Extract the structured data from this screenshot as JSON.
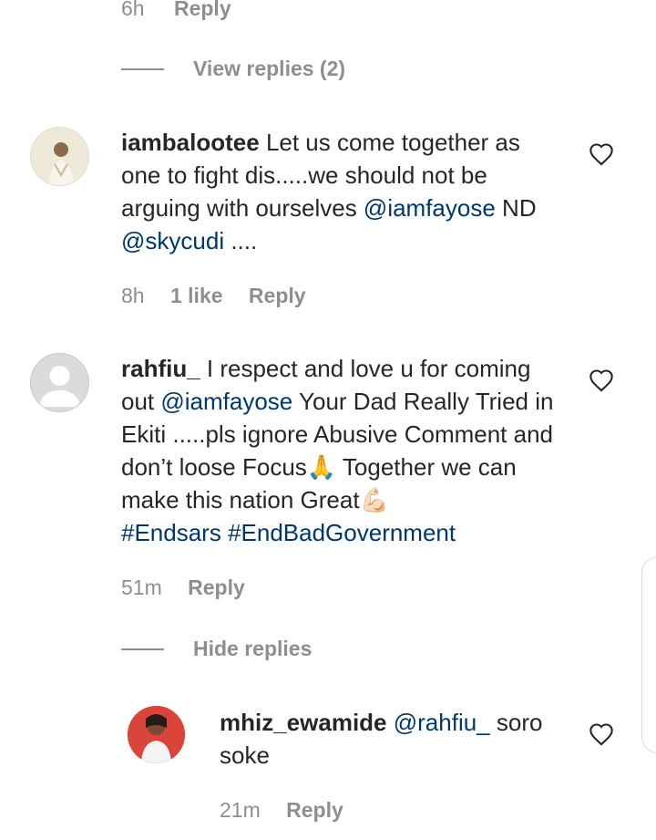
{
  "top": {
    "time": "6h",
    "reply": "Reply"
  },
  "view_replies": "View replies (2)",
  "comments": [
    {
      "username": "iambalootee",
      "text_parts": [
        " Let us come together as one to fight dis.....we should not be arguing with ourselves ",
        "@iamfayose",
        " ND ",
        "@skycudi",
        " ...."
      ],
      "time": "8h",
      "likes": "1 like",
      "reply": "Reply"
    },
    {
      "username": "rahfiu_",
      "text_parts": [
        " I respect and love u for coming out ",
        "@iamfayose",
        " Your Dad Really Tried in Ekiti .....pls ignore Abusive Comment and don’t loose Focus",
        "🙏",
        " Together we can make this nation Great",
        "💪🏻",
        "#Endsars #EndBadGovernment"
      ],
      "time": "51m",
      "reply": "Reply"
    }
  ],
  "hide_replies": "Hide replies",
  "reply_comment": {
    "username": "mhiz_ewamide",
    "mention": "@rahfiu_",
    "text": " soro soke",
    "time": "21m",
    "reply": "Reply"
  },
  "colors": {
    "mention": "#00376b",
    "meta": "#8e8e8e",
    "text": "#262626"
  },
  "icons": [
    "heart-icon",
    "avatar-placeholder-icon",
    "praying-hands-emoji",
    "flexed-biceps-emoji"
  ]
}
